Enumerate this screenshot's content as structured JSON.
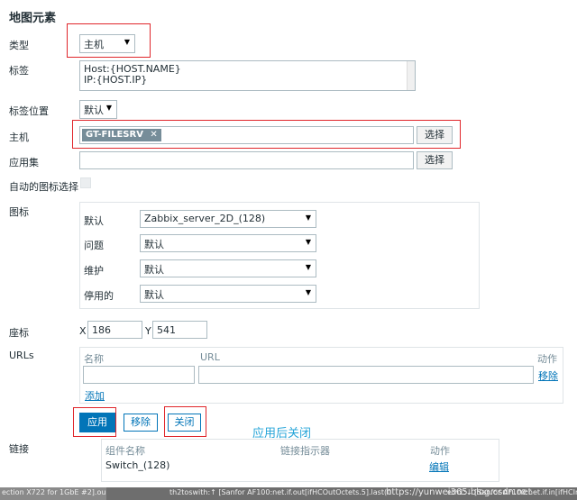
{
  "title": "地图元素",
  "type": {
    "label": "类型",
    "value": "主机"
  },
  "label_field": {
    "label": "标签",
    "lines": [
      "Host:{HOST.NAME}",
      "IP:{HOST.IP}"
    ]
  },
  "label_location": {
    "label": "标签位置",
    "value": "默认"
  },
  "host": {
    "label": "主机",
    "tag": "GT-FILESRV",
    "select_button": "选择"
  },
  "application": {
    "label": "应用集",
    "select_button": "选择"
  },
  "auto_icon": {
    "label": "自动的图标选择"
  },
  "icons": {
    "label": "图标",
    "rows": [
      {
        "label": "默认",
        "value": "Zabbix_server_2D_(128)"
      },
      {
        "label": "问题",
        "value": "默认"
      },
      {
        "label": "维护",
        "value": "默认"
      },
      {
        "label": "停用的",
        "value": "默认"
      }
    ]
  },
  "coordinates": {
    "label": "座标",
    "x_label": "X",
    "x_value": "186",
    "y_label": "Y",
    "y_value": "541"
  },
  "urls": {
    "label": "URLs",
    "headers": {
      "name": "名称",
      "url": "URL",
      "action": "动作"
    },
    "remove_link": "移除",
    "add_link": "添加"
  },
  "buttons": {
    "apply": "应用",
    "remove": "移除",
    "close": "关闭"
  },
  "annotation": "应用后关闭",
  "links": {
    "label": "链接",
    "headers": {
      "element": "组件名称",
      "indicator": "链接指示器",
      "action": "动作"
    },
    "rows": [
      {
        "name": "Switch_(128)",
        "action": "编辑"
      }
    ]
  },
  "footer": {
    "text_left": "ection X722 for 1GbE #2].ou",
    "text_mid": "th2toswith:↑ [Sanfor AF100:net.if.out[ifHCOutOctets.5].last(0",
    "text_right": "eth1:↓ [Sanfor AF100:net.if.in[ifHCInO",
    "watermark": "https://yunwei365.blog.csdn.net"
  },
  "colors": {
    "accent": "#0275b8",
    "highlight": "#e0262b",
    "annotation": "#25a4d8"
  }
}
